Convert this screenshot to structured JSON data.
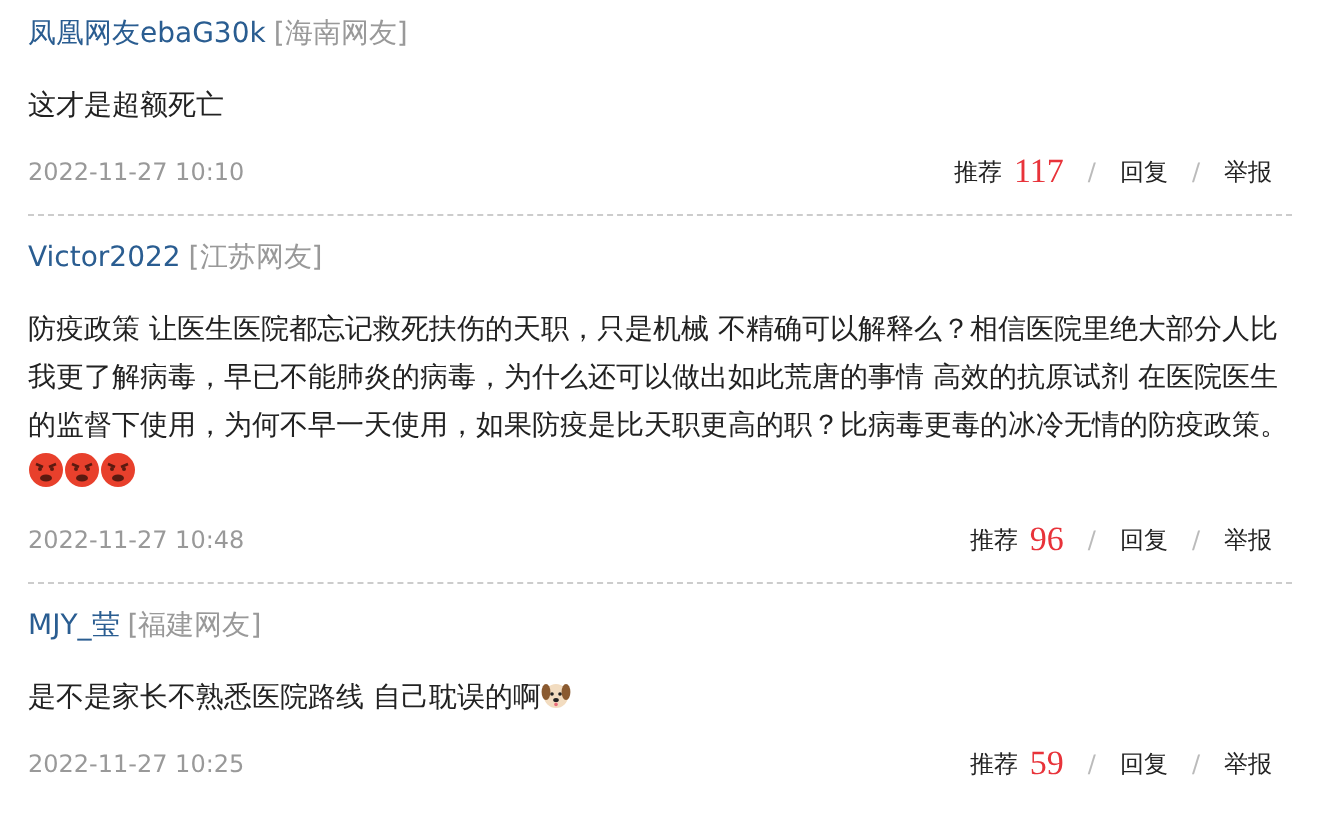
{
  "comments": [
    {
      "user": "凤凰网友ebaG30k",
      "region": "[海南网友]",
      "text": "这才是超额死亡",
      "time": "2022-11-27 10:10",
      "actions": {
        "recommend": "推荐",
        "count": "117",
        "separator_1": "/",
        "reply": "回复",
        "separator_2": "/",
        "report": "举报"
      }
    },
    {
      "user": "Victor2022",
      "region": "[江苏网友]",
      "text": "防疫政策 让医生医院都忘记救死扶伤的天职，只是机械 不精确可以解释么？相信医院里绝大部分人比我更了解病毒，早已不能肺炎的病毒，为什么还可以做出如此荒唐的事情 高效的抗原试剂 在医院医生的监督下使用，为何不早一天使用，如果防疫是比天职更高的职？比病毒更毒的冰冷无情的防疫政策。",
      "emoji": [
        {
          "kind": "angry"
        },
        {
          "kind": "angry"
        },
        {
          "kind": "angry"
        }
      ],
      "time": "2022-11-27 10:48",
      "actions": {
        "recommend": "推荐",
        "count": "96",
        "separator_1": "/",
        "reply": "回复",
        "separator_2": "/",
        "report": "举报"
      }
    },
    {
      "user": "MJY_莹",
      "region": "[福建网友]",
      "text": "是不是家长不熟悉医院路线 自己耽误的啊",
      "emoji": [
        {
          "kind": "dog"
        }
      ],
      "time": "2022-11-27 10:25",
      "actions": {
        "recommend": "推荐",
        "count": "59",
        "separator_1": "/",
        "reply": "回复",
        "separator_2": "/",
        "report": "举报"
      }
    }
  ]
}
